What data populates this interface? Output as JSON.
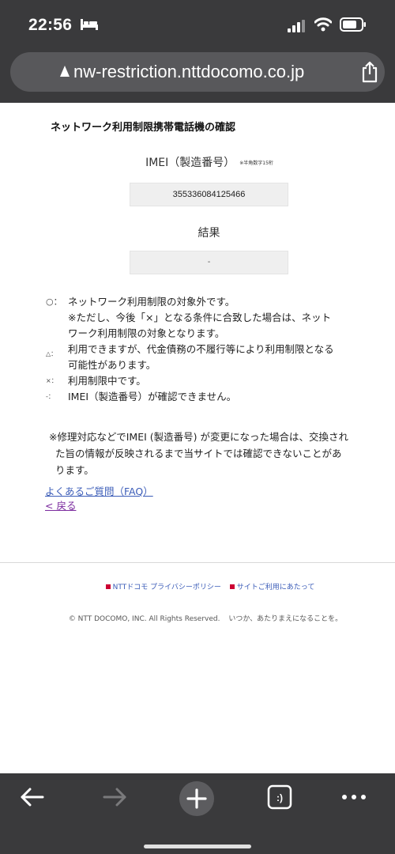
{
  "status_bar": {
    "time": "22:56"
  },
  "browser": {
    "url": "nw-restriction.nttdocomo.co.jp"
  },
  "page": {
    "title": "ネットワーク利用制限携帯電話機の確認",
    "imei_label": "IMEI（製造番号）",
    "imei_note": "※半角数字15桁",
    "imei_value": "355336084125466",
    "result_label": "結果",
    "result_value": "-"
  },
  "legend": [
    {
      "mark": "○：",
      "text": "ネットワーク利用制限の対象外です。"
    },
    {
      "mark": "",
      "text": "※ただし、今後「×」となる条件に合致した場合は、ネット"
    },
    {
      "mark": "",
      "text": "ワーク利用制限の対象となります。"
    },
    {
      "mark": "△：",
      "text": "利用できますが、代金債務の不履行等により利用制限となる"
    },
    {
      "mark": "",
      "text": "可能性があります。"
    },
    {
      "mark": "×：",
      "text": "利用制限中です。"
    },
    {
      "mark": "-：",
      "text": "IMEI（製造番号）が確認できません。"
    }
  ],
  "notice": {
    "line1": "※修理対応などでIMEI (製造番号) が変更になった場合は、交換され",
    "line2": "た旨の情報が反映されるまで当サイトでは確認できないことがあ",
    "line3": "ります。"
  },
  "links": {
    "faq": "よくあるご質問（FAQ）",
    "back": "< 戻る"
  },
  "footer": {
    "privacy": "NTTドコモ プライバシーポリシー",
    "terms": "サイトご利用にあたって",
    "copyright": "© NTT DOCOMO, INC. All Rights Reserved.",
    "slogan": "いつか、あたりまえになることを。"
  },
  "icons": {
    "status": [
      "bed-icon",
      "signal-icon",
      "wifi-icon",
      "battery-icon"
    ],
    "urlbar": [
      "lock-icon",
      "share-icon"
    ],
    "toolbar": [
      "back-arrow-icon",
      "forward-arrow-icon",
      "new-tab-icon",
      "tabs-icon",
      "more-icon"
    ],
    "tabs_icon_glyph": ":)"
  },
  "colors": {
    "chrome": "#3a3a3c",
    "urlbar": "#58585b",
    "link": "#3b5cb8",
    "visited_link": "#7b2a9e",
    "docomo_red": "#cc0033"
  }
}
